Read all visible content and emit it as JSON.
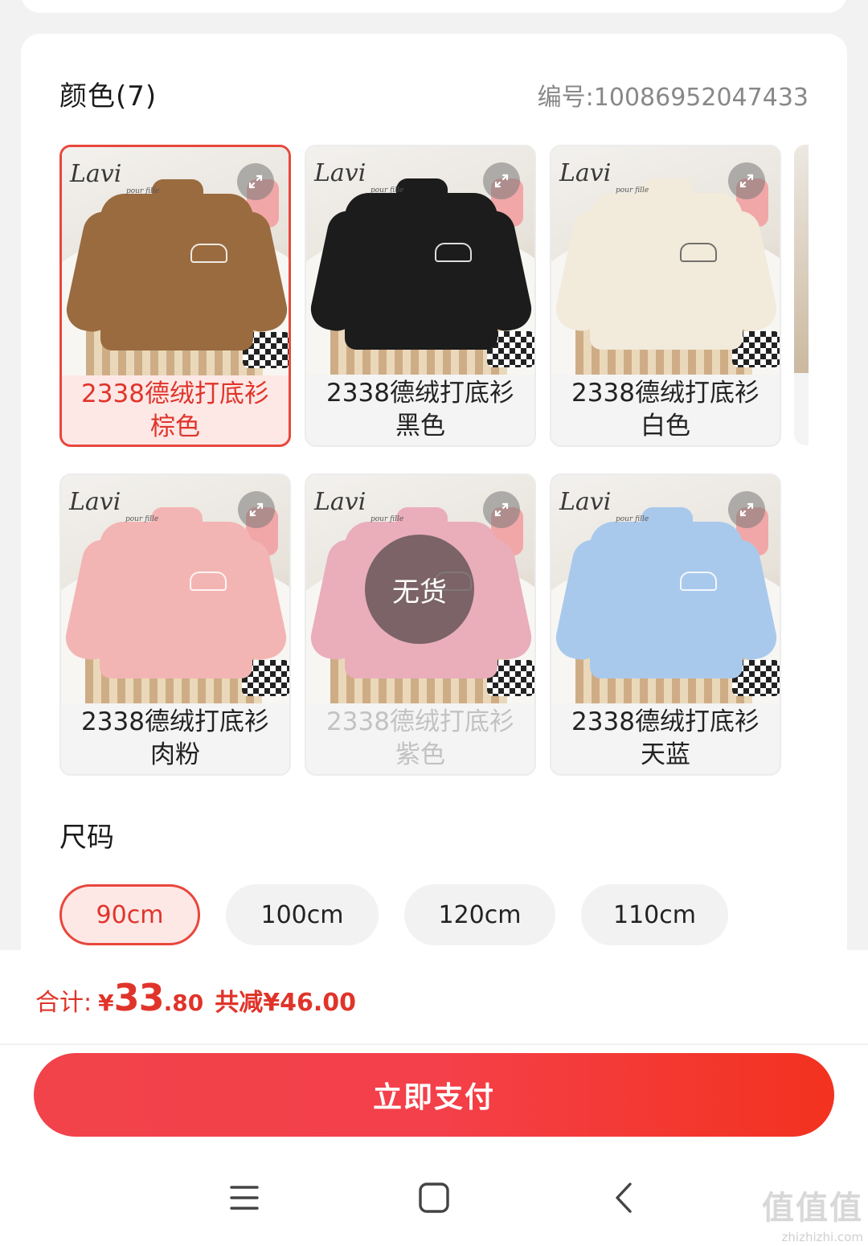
{
  "color_section": {
    "title": "颜色(7)",
    "item_number": "编号:10086952047433",
    "swatches": [
      {
        "label": "2338德绒打底衫棕色",
        "shirt_color": "#9a6b3f",
        "selected": true,
        "out_of_stock": false,
        "logo": "light"
      },
      {
        "label": "2338德绒打底衫黑色",
        "shirt_color": "#1c1c1c",
        "selected": false,
        "out_of_stock": false,
        "logo": "light"
      },
      {
        "label": "2338德绒打底衫白色",
        "shirt_color": "#f2eadb",
        "selected": false,
        "out_of_stock": false,
        "logo": "dark"
      },
      {
        "label": "2338德绒打底衫肉粉",
        "shirt_color": "#f3b5b3",
        "selected": false,
        "out_of_stock": false,
        "logo": "light"
      },
      {
        "label": "2338德绒打底衫紫色",
        "shirt_color": "#e9aeba",
        "selected": false,
        "out_of_stock": true,
        "logo": "light"
      },
      {
        "label": "2338德绒打底衫天蓝",
        "shirt_color": "#a9c9ec",
        "selected": false,
        "out_of_stock": false,
        "logo": "light"
      }
    ],
    "photo_brand": "Lavi",
    "photo_brand_sub": "pour fille",
    "out_of_stock_label": "无货",
    "expand_icon": "expand-icon"
  },
  "size_section": {
    "title": "尺码",
    "options": [
      {
        "label": "90cm",
        "selected": true
      },
      {
        "label": "100cm",
        "selected": false
      },
      {
        "label": "120cm",
        "selected": false
      },
      {
        "label": "110cm",
        "selected": false
      }
    ]
  },
  "summary": {
    "total_label": "合计:",
    "currency": "¥",
    "price_integer": "33",
    "price_decimal": ".80",
    "discount": "共减¥46.00"
  },
  "pay_button_label": "立即支付",
  "nav": {
    "menu_icon": "menu-icon",
    "home_icon": "home-square-icon",
    "back_icon": "back-chevron-icon"
  },
  "watermark": {
    "main": "值值值",
    "site": "zhizhizhi.com"
  },
  "colors": {
    "accent": "#e8473c",
    "accent_bg": "#fde8e6",
    "pay_button_start": "#f2424a",
    "pay_button_end": "#f3321f"
  }
}
